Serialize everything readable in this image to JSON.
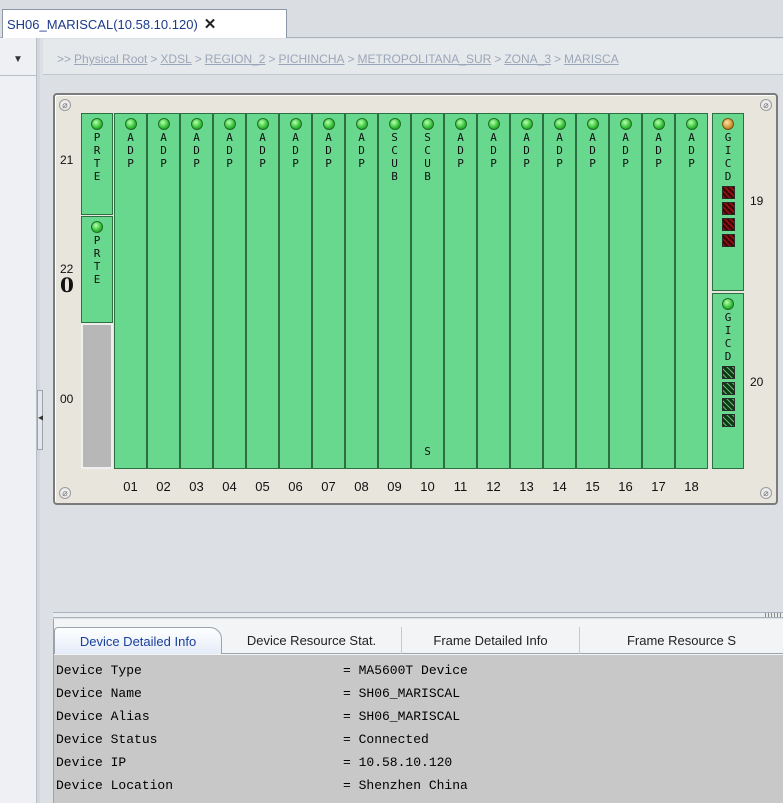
{
  "tab": {
    "title": "SH06_MARISCAL(10.58.10.120)",
    "close_glyph": "✕"
  },
  "breadcrumb": {
    "prefix": ">>",
    "separator": ">",
    "items": [
      "Physical Root",
      "XDSL",
      "REGION_2",
      "PICHINCHA",
      "METROPOLITANA_SUR",
      "ZONA_3",
      "MARISCA"
    ]
  },
  "shelf": {
    "left_row_labels": {
      "top": "21",
      "middle": "22",
      "bottom": "00",
      "indicator": "0"
    },
    "right_row_labels": {
      "top": "19",
      "bottom": "20"
    },
    "left_boards": [
      {
        "label": "PRTE",
        "led": "green"
      },
      {
        "label": "PRTE",
        "led": "green"
      }
    ],
    "slots": [
      {
        "num": "01",
        "label": "ADP",
        "led": "green"
      },
      {
        "num": "02",
        "label": "ADP",
        "led": "green"
      },
      {
        "num": "03",
        "label": "ADP",
        "led": "green"
      },
      {
        "num": "04",
        "label": "ADP",
        "led": "green"
      },
      {
        "num": "05",
        "label": "ADP",
        "led": "green"
      },
      {
        "num": "06",
        "label": "ADP",
        "led": "green"
      },
      {
        "num": "07",
        "label": "ADP",
        "led": "green"
      },
      {
        "num": "08",
        "label": "ADP",
        "led": "green"
      },
      {
        "num": "09",
        "label": "SCUB",
        "led": "green",
        "mark": ""
      },
      {
        "num": "10",
        "label": "SCUB",
        "led": "green",
        "mark": "S"
      },
      {
        "num": "11",
        "label": "ADP",
        "led": "green"
      },
      {
        "num": "12",
        "label": "ADP",
        "led": "green"
      },
      {
        "num": "13",
        "label": "ADP",
        "led": "green"
      },
      {
        "num": "14",
        "label": "ADP",
        "led": "green"
      },
      {
        "num": "15",
        "label": "ADP",
        "led": "green"
      },
      {
        "num": "16",
        "label": "ADP",
        "led": "green"
      },
      {
        "num": "17",
        "label": "ADP",
        "led": "green"
      },
      {
        "num": "18",
        "label": "ADP",
        "led": "green"
      }
    ],
    "right_boards": [
      {
        "label": "GICD",
        "led": "orange",
        "port_state": "red",
        "ports": 4
      },
      {
        "label": "GICD",
        "led": "green",
        "port_state": "dark",
        "ports": 4
      }
    ]
  },
  "details": {
    "tabs": [
      "Device Detailed Info",
      "Device Resource Stat.",
      "Frame Detailed Info",
      "Frame Resource S"
    ],
    "active_tab": 0,
    "rows": [
      {
        "label": "Device Type",
        "value": "= MA5600T Device"
      },
      {
        "label": "Device Name",
        "value": "= SH06_MARISCAL"
      },
      {
        "label": "Device Alias",
        "value": "= SH06_MARISCAL"
      },
      {
        "label": "Device Status",
        "value": "= Connected"
      },
      {
        "label": "Device IP",
        "value": "= 10.58.10.120"
      },
      {
        "label": "Device Location",
        "value": "= Shenzhen China"
      }
    ]
  }
}
